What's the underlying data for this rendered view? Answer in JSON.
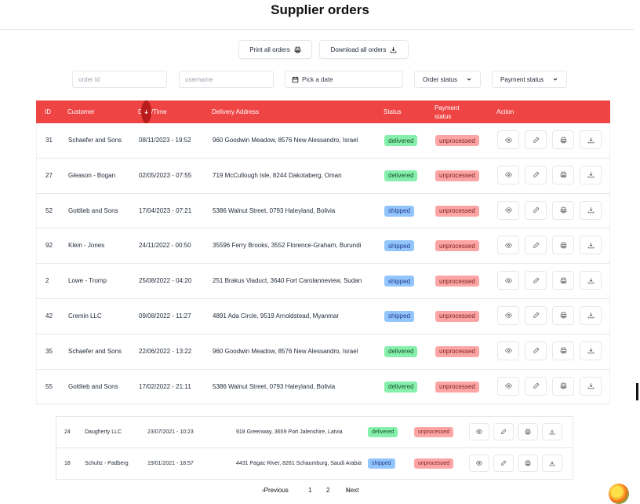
{
  "page": {
    "title": "Supplier orders"
  },
  "toolbar": {
    "print_label": "Print all orders",
    "download_label": "Download all orders"
  },
  "filters": {
    "order_id_placeholder": "order id",
    "username_placeholder": "username",
    "date_label": "Pick a date",
    "order_status_label": "Order status",
    "payment_status_label": "Payment status"
  },
  "table": {
    "headers": {
      "id": "ID",
      "customer": "Customer",
      "datetime": "Date/Time",
      "address": "Delivery Address",
      "status": "Status",
      "payment_status": "Payment status",
      "action": "Action"
    },
    "rows": [
      {
        "id": "31",
        "customer": "Schaefer and Sons",
        "datetime": "08/11/2023 - 19:52",
        "address": "960 Goodwin Meadow, 8576 New Alessandro, Israel",
        "status": "delivered",
        "payment": "unprocessed"
      },
      {
        "id": "27",
        "customer": "Gleason - Bogan",
        "datetime": "02/05/2023 - 07:55",
        "address": "719 McCullough Isle, 8244 Dakotaberg, Oman",
        "status": "delivered",
        "payment": "unprocessed"
      },
      {
        "id": "52",
        "customer": "Gottlieb and Sons",
        "datetime": "17/04/2023 - 07:21",
        "address": "5386 Walnut Street, 0793 Haleyland, Bolivia",
        "status": "shipped",
        "payment": "unprocessed"
      },
      {
        "id": "92",
        "customer": "Klein - Jones",
        "datetime": "24/11/2022 - 00:50",
        "address": "35596 Ferry Brooks, 3552 Florence-Graham, Burundi",
        "status": "shipped",
        "payment": "unprocessed"
      },
      {
        "id": "2",
        "customer": "Lowe - Tromp",
        "datetime": "25/08/2022 - 04:20",
        "address": "251 Brakus Viaduct, 3640 Fort Carolanneview, Sudan",
        "status": "shipped",
        "payment": "unprocessed"
      },
      {
        "id": "42",
        "customer": "Cremin LLC",
        "datetime": "09/08/2022 - 11:27",
        "address": "4891 Ada Circle, 9519 Arnoldstead, Myanmar",
        "status": "shipped",
        "payment": "unprocessed"
      },
      {
        "id": "35",
        "customer": "Schaefer and Sons",
        "datetime": "22/06/2022 - 13:22",
        "address": "960 Goodwin Meadow, 8576 New Alessandro, Israel",
        "status": "delivered",
        "payment": "unprocessed"
      },
      {
        "id": "55",
        "customer": "Gottlieb and Sons",
        "datetime": "17/02/2022 - 21:11",
        "address": "5386 Walnut Street, 0793 Haleyland, Bolivia",
        "status": "delivered",
        "payment": "unprocessed"
      }
    ],
    "rows_lower": [
      {
        "id": "24",
        "customer": "Daugherty LLC",
        "datetime": "23/07/2021 - 10:23",
        "address": "918 Greenway, 3659 Port Jalenshire, Latvia",
        "status": "delivered",
        "payment": "unprocessed"
      },
      {
        "id": "18",
        "customer": "Schultz - Padberg",
        "datetime": "19/01/2021 - 18:57",
        "address": "4431 Pagac River, 8261 Schaumburg, Saudi Arabia",
        "status": "shipped",
        "payment": "unprocessed"
      }
    ]
  },
  "pagination": {
    "previous": "Previous",
    "pages": [
      "1",
      "2"
    ],
    "next": "Next"
  },
  "icons": {
    "print": "printer-icon",
    "download": "download-icon",
    "calendar": "calendar-icon",
    "chevron": "chevron-down-icon",
    "sort": "arrow-down-icon",
    "view": "eye-icon",
    "edit": "pencil-icon"
  },
  "colors": {
    "header_bg": "#ef4444",
    "delivered": "#86efac",
    "shipped": "#93c5fd",
    "unprocessed": "#fca5a5"
  }
}
